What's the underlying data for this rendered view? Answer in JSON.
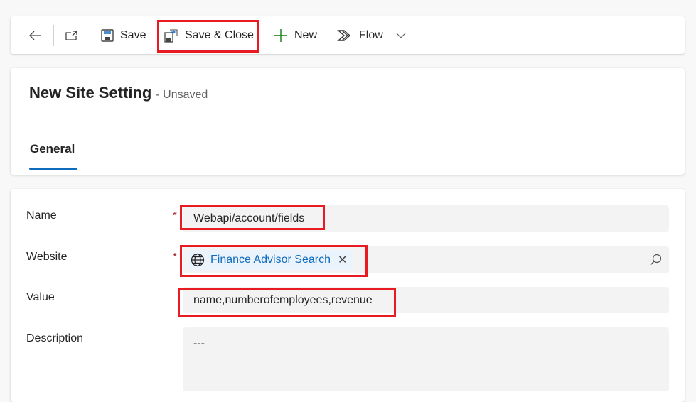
{
  "toolbar": {
    "save": "Save",
    "save_close": "Save & Close",
    "new": "New",
    "flow": "Flow"
  },
  "header": {
    "title": "New Site Setting",
    "status": "- Unsaved",
    "tab": "General"
  },
  "form": {
    "name_label": "Name",
    "name_value": "Webapi/account/fields",
    "website_label": "Website",
    "website_value": "Finance Advisor Search",
    "value_label": "Value",
    "value_value": "name,numberofemployees,revenue",
    "description_label": "Description",
    "description_placeholder": "---",
    "required_marker": "*"
  },
  "colors": {
    "highlight": "#e81b23",
    "accent": "#0f6cbd",
    "new_icon": "#107c10"
  }
}
